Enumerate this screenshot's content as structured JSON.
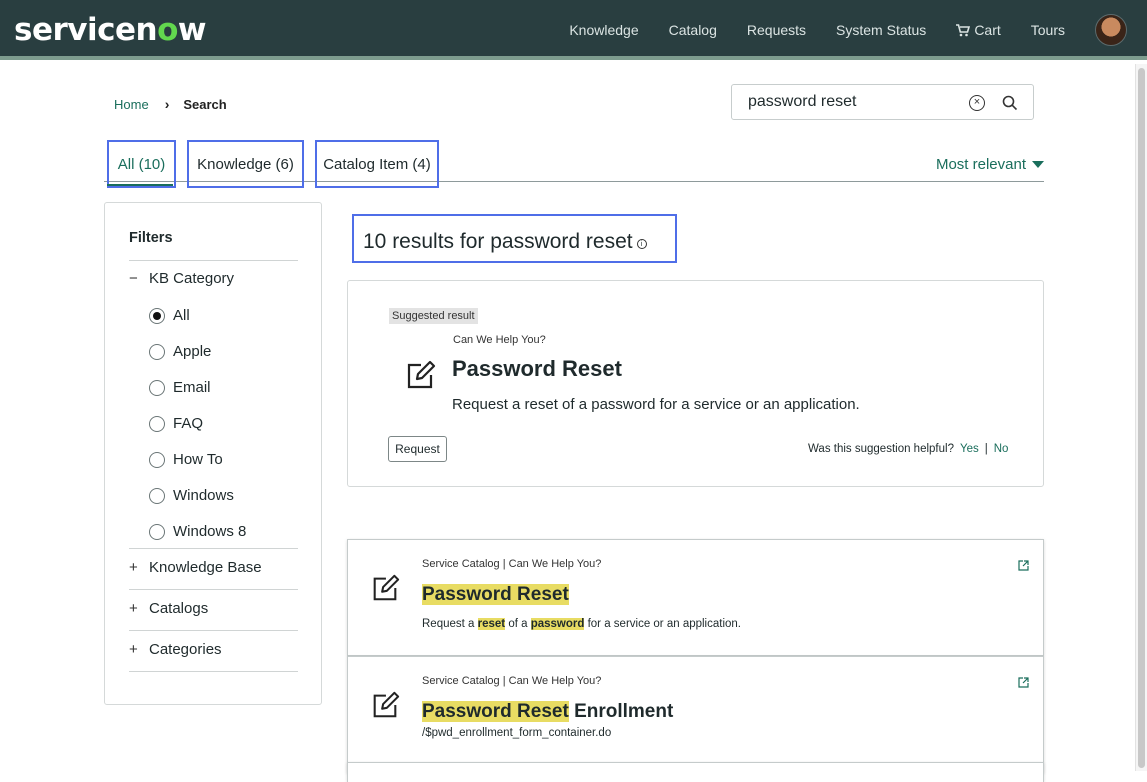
{
  "header": {
    "logo_prefix": "servicen",
    "logo_o": "o",
    "logo_suffix": "w",
    "nav": [
      "Knowledge",
      "Catalog",
      "Requests",
      "System Status",
      "Cart",
      "Tours"
    ],
    "cart_icon": "cart-icon",
    "avatar_icon": "user-avatar"
  },
  "breadcrumb": {
    "home": "Home",
    "current": "Search",
    "separator_icon": "chevron-right-icon"
  },
  "search": {
    "value": "password reset",
    "clear_icon": "circle-x-icon",
    "search_icon": "magnifier-icon"
  },
  "tabs": [
    {
      "label": "All (10)",
      "active": true
    },
    {
      "label": "Knowledge (6)",
      "active": false
    },
    {
      "label": "Catalog Item (4)",
      "active": false
    }
  ],
  "sort": {
    "label": "Most relevant",
    "icon": "caret-down-icon"
  },
  "filters": {
    "title": "Filters",
    "kb_category": {
      "label": "KB Category",
      "toggle": "−",
      "options": [
        "All",
        "Apple",
        "Email",
        "FAQ",
        "How To",
        "Windows",
        "Windows 8"
      ],
      "selected": "All"
    },
    "groups": [
      {
        "label": "Knowledge Base",
        "toggle": "+"
      },
      {
        "label": "Catalogs",
        "toggle": "+"
      },
      {
        "label": "Categories",
        "toggle": "+"
      }
    ]
  },
  "results": {
    "summary": "10 results for password reset",
    "info_icon": "info-circle-icon"
  },
  "suggested": {
    "badge": "Suggested result",
    "source": "Can We Help You?",
    "title": "Password Reset",
    "description": "Request a reset of a password for a service or an application.",
    "button": "Request",
    "helpful_question": "Was this suggestion helpful?",
    "yes": "Yes",
    "separator": "|",
    "no": "No",
    "icon": "edit-form-icon"
  },
  "result_items": [
    {
      "source": "Service Catalog | Can We Help You?",
      "title_highlight": "Password Reset",
      "title_rest": "",
      "desc_parts": [
        "Request a ",
        "reset",
        " of a ",
        "password",
        " for a service or an application."
      ],
      "icon": "edit-form-icon",
      "link_icon": "external-link-icon"
    },
    {
      "source": "Service Catalog | Can We Help You?",
      "title_highlight": "Password Reset",
      "title_rest": " Enrollment",
      "url": "/$pwd_enrollment_form_container.do",
      "icon": "edit-form-icon",
      "link_icon": "external-link-icon"
    }
  ],
  "colors": {
    "header_bg": "#293e40",
    "accent_green": "#1a6e5c",
    "logo_green": "#62d84e",
    "highlight": "#e8dc63",
    "annotation_box": "#4f6ee8"
  }
}
